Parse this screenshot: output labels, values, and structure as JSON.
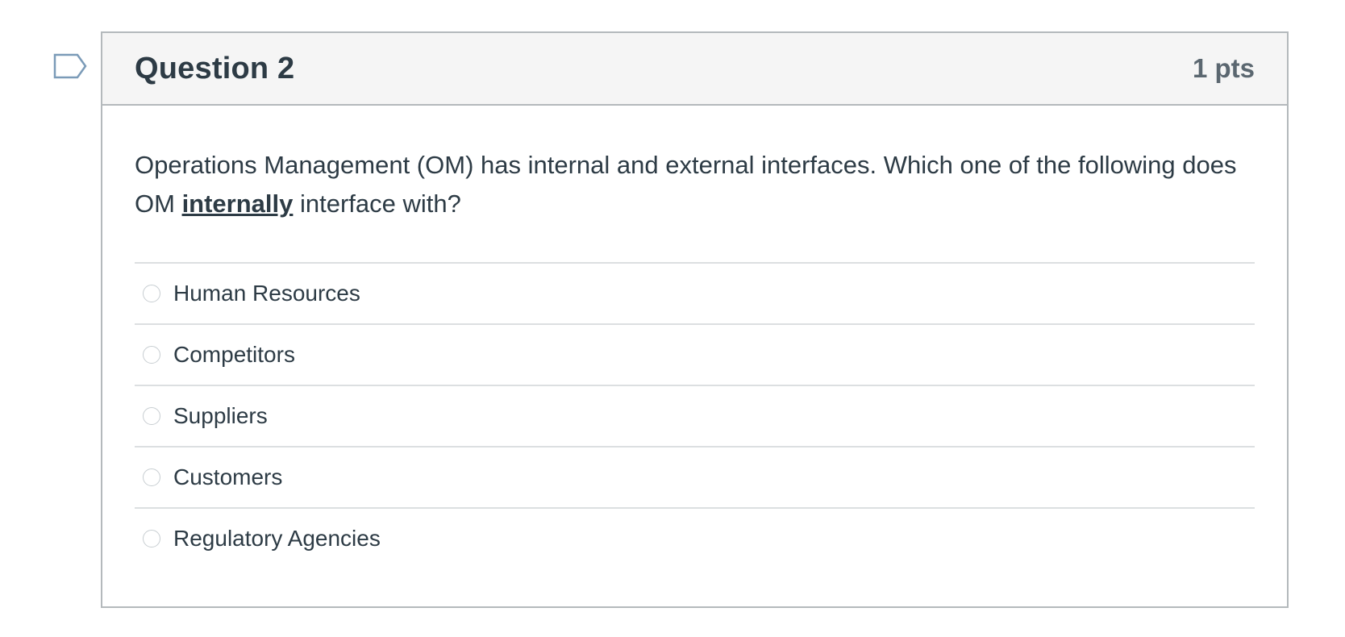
{
  "question": {
    "title": "Question 2",
    "points": "1 pts",
    "text_before": "Operations Management (OM) has internal and external interfaces. Which one of the following does OM ",
    "text_emphasis": "internally",
    "text_after": " interface with?",
    "answers": [
      {
        "label": "Human Resources"
      },
      {
        "label": "Competitors"
      },
      {
        "label": "Suppliers"
      },
      {
        "label": "Customers"
      },
      {
        "label": "Regulatory Agencies"
      }
    ]
  },
  "colors": {
    "header_bg": "#f5f5f5",
    "border": "#b4b9bc",
    "text": "#2d3b45",
    "flag_stroke": "#7b9bb8"
  }
}
